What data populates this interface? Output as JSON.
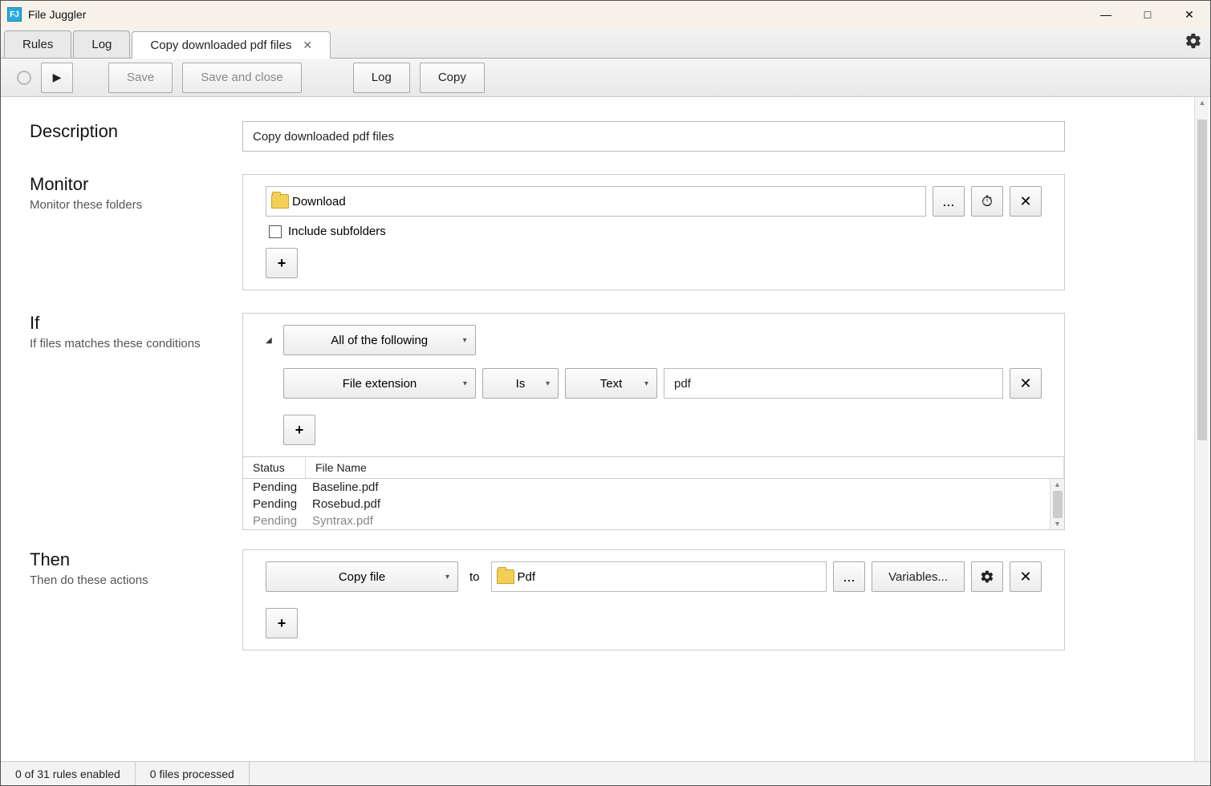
{
  "app": {
    "title": "File Juggler",
    "icon_label": "FJ"
  },
  "tabs": {
    "rules": "Rules",
    "log": "Log",
    "active": "Copy downloaded pdf files"
  },
  "toolbar": {
    "save": "Save",
    "save_close": "Save and close",
    "log": "Log",
    "copy": "Copy"
  },
  "description": {
    "label": "Description",
    "value": "Copy downloaded pdf files"
  },
  "monitor": {
    "label": "Monitor",
    "sub": "Monitor these folders",
    "folder": "Download",
    "browse": "...",
    "include_sub": "Include subfolders",
    "include_checked": false
  },
  "if": {
    "label": "If",
    "sub": "If files matches these conditions",
    "group": "All of the following",
    "cond_field": "File extension",
    "cond_op": "Is",
    "cond_type": "Text",
    "cond_value": "pdf"
  },
  "table": {
    "col_status": "Status",
    "col_name": "File Name",
    "rows": [
      {
        "status": "Pending",
        "name": "Baseline.pdf"
      },
      {
        "status": "Pending",
        "name": "Rosebud.pdf"
      },
      {
        "status": "Pending",
        "name": "Syntrax.pdf"
      }
    ]
  },
  "then": {
    "label": "Then",
    "sub": "Then do these actions",
    "action": "Copy file",
    "to": "to",
    "dest": "Pdf",
    "browse": "...",
    "vars": "Variables..."
  },
  "status": {
    "rules": "0 of 31 rules enabled",
    "files": "0 files processed"
  }
}
